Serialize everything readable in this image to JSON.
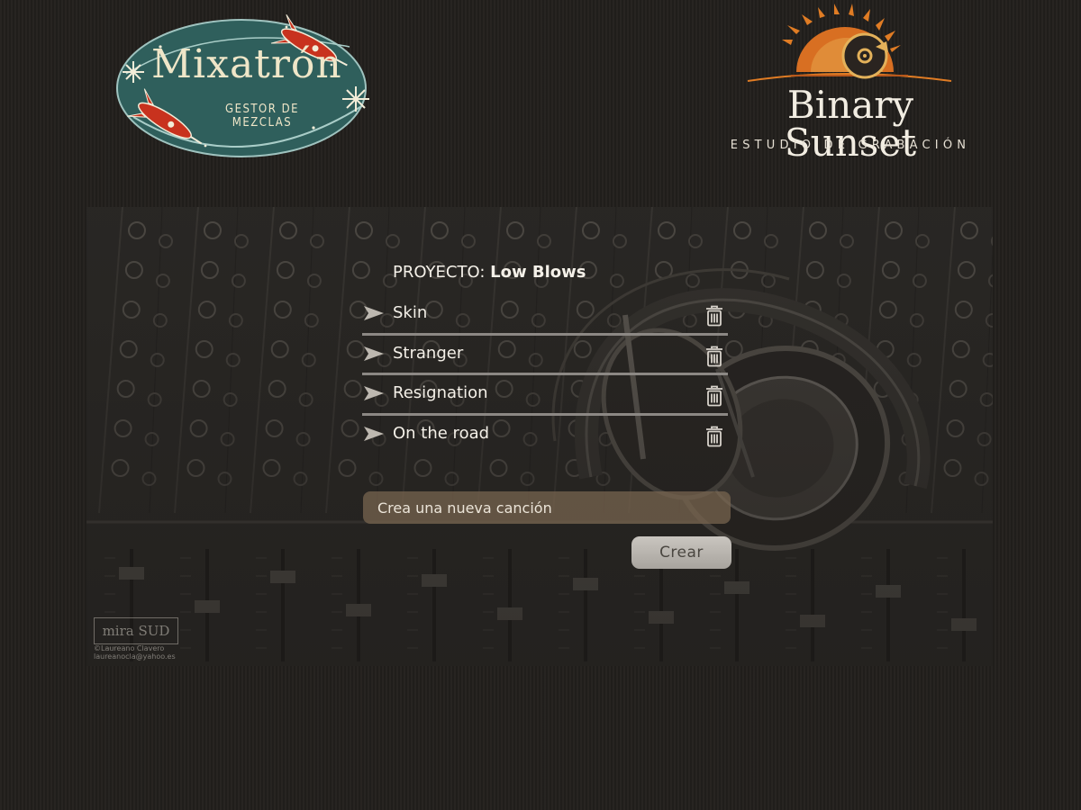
{
  "logos": {
    "mixatron": {
      "title": "Mixatrón",
      "subtitle": "GESTOR DE MEZCLAS",
      "oval_color": "#2f5f5c",
      "rocket_color": "#c8321e"
    },
    "binary_sunset": {
      "title": "Binary Sunset",
      "subtitle": "ESTUDIO DE GRABACIÓN",
      "sun_color": "#e07c24"
    }
  },
  "panel": {
    "watermark": {
      "brand": "mira SUD",
      "credit": "©Laureano Clavero",
      "email": "laureanocla@yahoo.es"
    }
  },
  "project": {
    "label": "PROYECTO:",
    "name": "Low Blows"
  },
  "songs": [
    {
      "name": "Skin",
      "play_icon": "play-arrow-icon",
      "delete_icon": "trash-icon"
    },
    {
      "name": "Stranger",
      "play_icon": "play-arrow-icon",
      "delete_icon": "trash-icon"
    },
    {
      "name": "Resignation",
      "play_icon": "play-arrow-icon",
      "delete_icon": "trash-icon"
    },
    {
      "name": "On the road",
      "play_icon": "play-arrow-icon",
      "delete_icon": "trash-icon"
    }
  ],
  "new_song": {
    "value": "",
    "placeholder": "Crea una nueva canción",
    "button_label": "Crear"
  },
  "colors": {
    "background": "#221f1c",
    "input_background": "#7a6650",
    "button_background": "#bdb9b3"
  }
}
